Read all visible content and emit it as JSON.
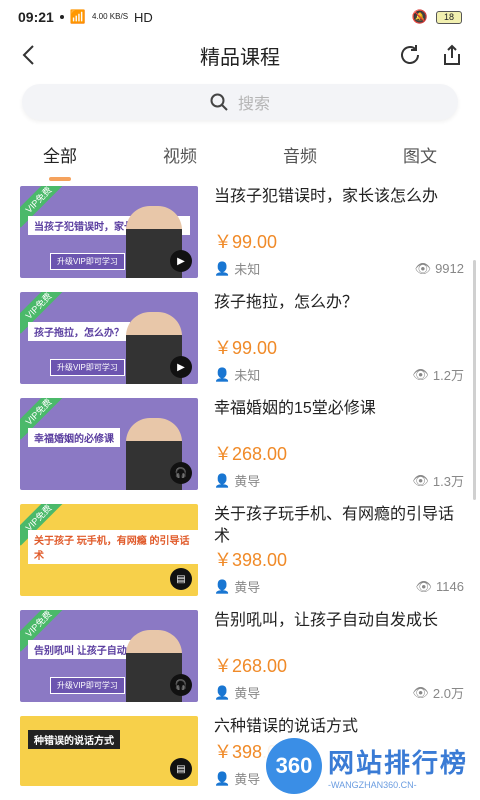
{
  "status": {
    "time": "09:21",
    "speed": "4.00\nKB/S",
    "network": "HD",
    "battery": "18"
  },
  "header": {
    "title": "精品课程"
  },
  "search": {
    "placeholder": "搜索"
  },
  "tabs": [
    {
      "label": "全部",
      "active": true
    },
    {
      "label": "视频",
      "active": false
    },
    {
      "label": "音频",
      "active": false
    },
    {
      "label": "图文",
      "active": false
    }
  ],
  "courses": [
    {
      "title": "当孩子犯错误时，家长该怎么办",
      "price": "￥99.00",
      "author": "未知",
      "views": "9912",
      "thumb": "purple",
      "badge": "play-icon",
      "banner": "当孩子犯错误时，家长该怎么办？"
    },
    {
      "title": "孩子拖拉，怎么办？",
      "price": "￥99.00",
      "author": "未知",
      "views": "1.2万",
      "thumb": "purple",
      "badge": "play-icon",
      "banner": "孩子拖拉，怎么办？"
    },
    {
      "title": "幸福婚姻的15堂必修课",
      "price": "￥268.00",
      "author": "黄导",
      "views": "1.3万",
      "thumb": "purple",
      "badge": "headphones-icon",
      "banner": "幸福婚姻的必修课"
    },
    {
      "title": "关于孩子玩手机、有网瘾的引导话术",
      "price": "￥398.00",
      "author": "黄导",
      "views": "1146",
      "thumb": "yellow",
      "badge": "document-icon",
      "banner": "关于孩子 玩手机，有网瘾 的引导话术"
    },
    {
      "title": "告别吼叫，让孩子自动自发成长",
      "price": "￥268.00",
      "author": "黄导",
      "views": "2.0万",
      "thumb": "purple",
      "badge": "headphones-icon",
      "banner": "告别吼叫 让孩子自动自发成长"
    },
    {
      "title": "六种错误的说话方式",
      "price": "￥398.00",
      "author": "黄导",
      "views": "",
      "thumb": "yellow",
      "badge": "document-icon",
      "banner": "种错误的说话方式"
    }
  ],
  "watermark": {
    "logo": "360",
    "name": "网站排行榜",
    "url": "-WANGZHAN360.CN-"
  },
  "colors": {
    "accent": "#f08a28",
    "tab_indicator": "#f5a25d",
    "vip_badge": "#4bb96a",
    "thumb_purple": "#8b79c4",
    "thumb_yellow": "#f7d04a"
  }
}
